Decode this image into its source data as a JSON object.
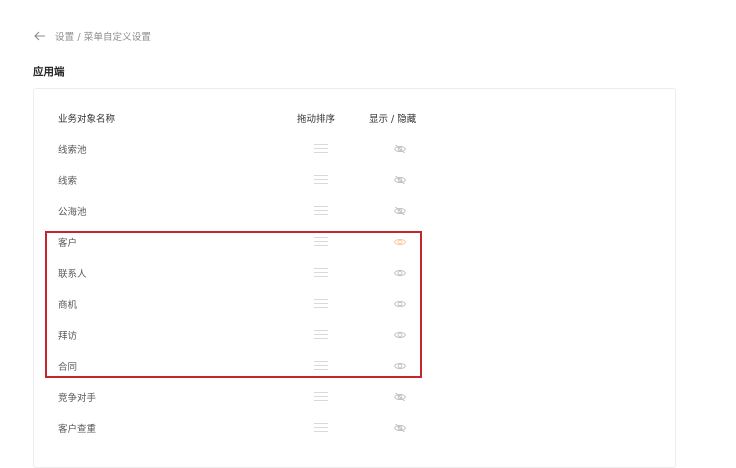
{
  "breadcrumb": {
    "path": "设置 / 菜单自定义设置"
  },
  "section": {
    "title": "应用端"
  },
  "table": {
    "headers": {
      "name": "业务对象名称",
      "sort": "拖动排序",
      "visibility": "显示 / 隐藏"
    },
    "rows": [
      {
        "name": "线索池",
        "state": "hidden"
      },
      {
        "name": "线索",
        "state": "hidden"
      },
      {
        "name": "公海池",
        "state": "hidden"
      },
      {
        "name": "客户",
        "state": "shown-active"
      },
      {
        "name": "联系人",
        "state": "shown"
      },
      {
        "name": "商机",
        "state": "shown"
      },
      {
        "name": "拜访",
        "state": "shown"
      },
      {
        "name": "合同",
        "state": "shown"
      },
      {
        "name": "竞争对手",
        "state": "hidden"
      },
      {
        "name": "客户查重",
        "state": "hidden"
      }
    ]
  },
  "colors": {
    "highlight_border": "#c3272b",
    "active_eye": "#f5c8a0",
    "inactive_eye": "#bfbfbf",
    "drag_handle": "#d9d9d9"
  },
  "icons": {
    "back": "arrow-left-icon",
    "drag": "drag-handle-icon",
    "eye_shown": "eye-icon",
    "eye_hidden": "eye-slash-icon"
  }
}
